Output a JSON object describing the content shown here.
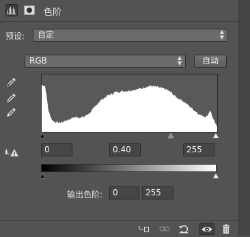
{
  "panel": {
    "title": "色阶"
  },
  "preset": {
    "label": "预设:",
    "value": "自定"
  },
  "channel": {
    "value": "RGB",
    "auto_label": "自动"
  },
  "input_levels": {
    "black": "0",
    "gamma": "0.40",
    "white": "255"
  },
  "output_levels": {
    "label": "输出色阶:",
    "black": "0",
    "white": "255"
  },
  "icons": {
    "header": [
      "levels-icon",
      "mask-icon"
    ],
    "eyedroppers": [
      "black-eyedropper-icon",
      "gray-eyedropper-icon",
      "white-eyedropper-icon"
    ],
    "warning": "clipping-warning-icon",
    "footer": [
      "clip-to-layer-icon",
      "view-previous-icon",
      "reset-icon",
      "visibility-eye-icon",
      "trash-icon"
    ]
  },
  "chart_data": {
    "type": "area",
    "x_range": [
      0,
      255
    ],
    "histogram": [
      0.82,
      0.8,
      0.35,
      0.2,
      0.17,
      0.16,
      0.17,
      0.2,
      0.22,
      0.25,
      0.26,
      0.25,
      0.26,
      0.3,
      0.35,
      0.42,
      0.5,
      0.56,
      0.6,
      0.64,
      0.66,
      0.69,
      0.7,
      0.71,
      0.71,
      0.72,
      0.73,
      0.74,
      0.75,
      0.77,
      0.79,
      0.8,
      0.79,
      0.78,
      0.76,
      0.75,
      0.72,
      0.68,
      0.62,
      0.58,
      0.55,
      0.5,
      0.45,
      0.4,
      0.35,
      0.3,
      0.28,
      0.26,
      0.38,
      0.2,
      0.08
    ]
  }
}
